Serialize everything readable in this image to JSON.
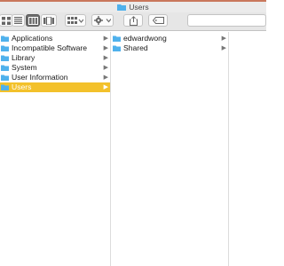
{
  "window": {
    "title": "Users",
    "accent": "#f3c12b",
    "folder_color": "#4fb1ec"
  },
  "toolbar": {
    "buttons": [
      {
        "name": "icon-view-button",
        "icon": "grid-icon"
      },
      {
        "name": "list-view-button",
        "icon": "list-icon"
      },
      {
        "name": "column-view-button",
        "icon": "columns-icon",
        "active": true
      },
      {
        "name": "cover-flow-button",
        "icon": "cover-flow-icon"
      },
      {
        "name": "arrange-button",
        "icon": "arrange-icon"
      },
      {
        "name": "action-button",
        "icon": "gear-icon"
      },
      {
        "name": "share-button",
        "icon": "share-icon"
      },
      {
        "name": "tag-button",
        "icon": "tag-icon"
      }
    ],
    "search_placeholder": ""
  },
  "columns": {
    "col1": {
      "items": [
        {
          "label": "Applications",
          "has_children": true,
          "selected": false
        },
        {
          "label": "Incompatible Software",
          "has_children": true,
          "selected": false
        },
        {
          "label": "Library",
          "has_children": true,
          "selected": false
        },
        {
          "label": "System",
          "has_children": true,
          "selected": false
        },
        {
          "label": "User Information",
          "has_children": true,
          "selected": false
        },
        {
          "label": "Users",
          "has_children": true,
          "selected": true
        }
      ]
    },
    "col2": {
      "items": [
        {
          "label": "edwardwong",
          "has_children": true,
          "selected": false
        },
        {
          "label": "Shared",
          "has_children": true,
          "selected": false
        }
      ]
    }
  }
}
